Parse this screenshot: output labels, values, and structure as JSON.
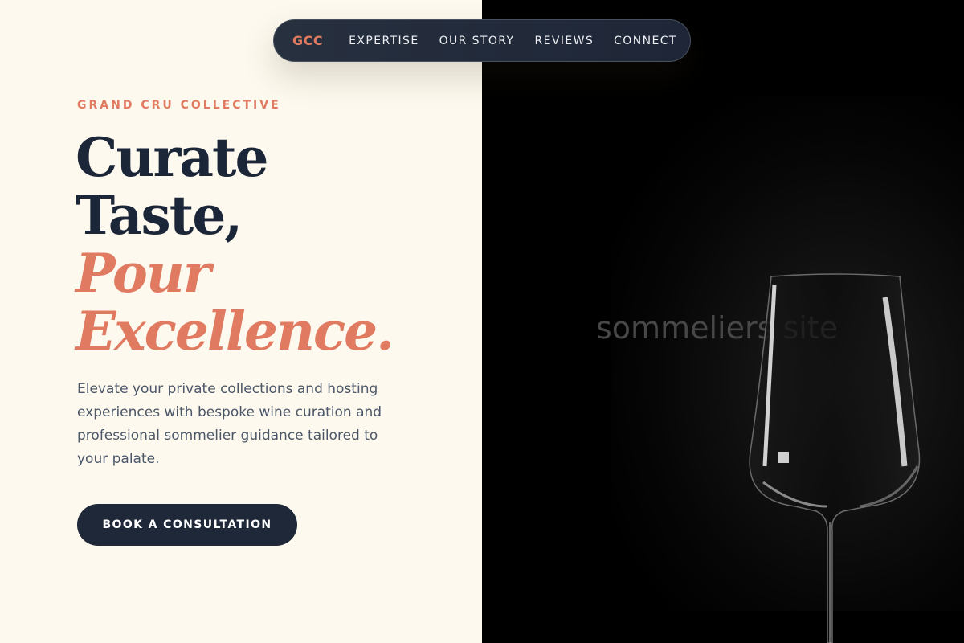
{
  "nav": {
    "logo": "GCC",
    "links": [
      "EXPERTISE",
      "OUR STORY",
      "REVIEWS",
      "CONNECT"
    ]
  },
  "hero": {
    "eyebrow": "GRAND CRU COLLECTIVE",
    "headline_line1": "Curate",
    "headline_line2": "Taste,",
    "headline_accent1": "Pour",
    "headline_accent2": "Excellence.",
    "lead": "Elevate your private collections and hosting experiences with bespoke wine curation and professional sommelier guidance tailored to your palate.",
    "cta_label": "BOOK A CONSULTATION"
  },
  "image": {
    "alt_text": "sommeliers site",
    "icon": "wine-glass-icon"
  },
  "colors": {
    "accent": "#e07a60",
    "navy": "#1c2639",
    "cream": "#fdf9ee",
    "body_text": "#4b5769"
  }
}
